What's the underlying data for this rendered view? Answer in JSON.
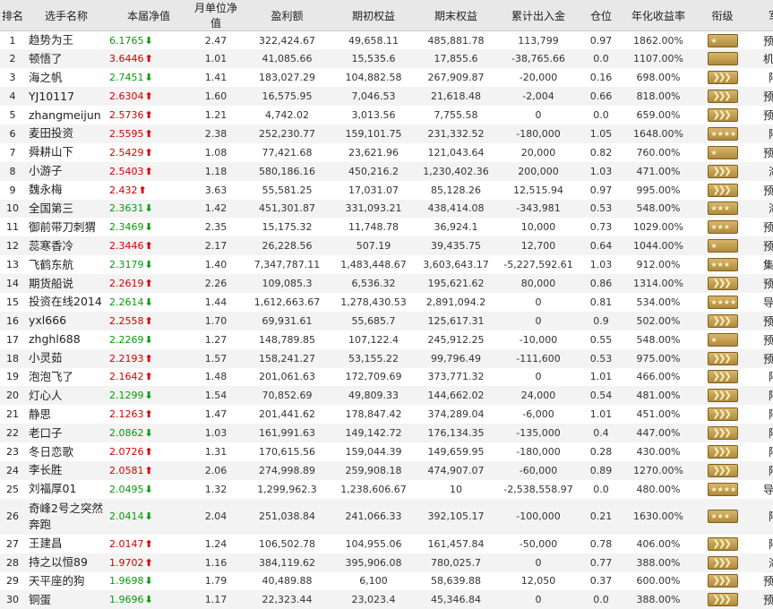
{
  "headers": [
    "排名",
    "选手名称",
    "本届净值",
    "月单位净值",
    "盈利额",
    "期初权益",
    "期末权益",
    "累计出入金",
    "仓位",
    "年化收益率",
    "衔级",
    "军种"
  ],
  "rows": [
    {
      "rank": "1",
      "name": "趋势为王",
      "nav": "6.1765",
      "dir": "down",
      "unit": "2.47",
      "profit": "322,424.67",
      "start": "49,658.11",
      "end": "485,881.78",
      "flow": "113,799",
      "pos": "0.97",
      "annual": "1862.00%",
      "badge": "stripe1",
      "army": "预备役"
    },
    {
      "rank": "2",
      "name": "顿悟了",
      "nav": "3.6446",
      "dir": "up",
      "unit": "1.01",
      "profit": "41,085.66",
      "start": "15,535.6",
      "end": "17,855.6",
      "flow": "-38,765.66",
      "pos": "0.0",
      "annual": "1107.00%",
      "badge": "stripe0",
      "army": "机枪手"
    },
    {
      "rank": "3",
      "name": "海之帆",
      "nav": "2.7451",
      "dir": "down",
      "unit": "1.41",
      "profit": "183,027.29",
      "start": "104,882.58",
      "end": "267,909.87",
      "flow": "-20,000",
      "pos": "0.16",
      "annual": "698.00%",
      "badge": "chev",
      "army": "陆军"
    },
    {
      "rank": "4",
      "name": "YJ10117",
      "nav": "2.6304",
      "dir": "up",
      "unit": "1.60",
      "profit": "16,575.95",
      "start": "7,046.53",
      "end": "21,618.48",
      "flow": "-2,004",
      "pos": "0.66",
      "annual": "818.00%",
      "badge": "chev",
      "army": "预备役"
    },
    {
      "rank": "5",
      "name": "zhangmeijun",
      "nav": "2.5736",
      "dir": "up",
      "unit": "1.21",
      "profit": "4,742.02",
      "start": "3,013.56",
      "end": "7,755.58",
      "flow": "0",
      "pos": "0.0",
      "annual": "659.00%",
      "badge": "chev",
      "army": "预备役"
    },
    {
      "rank": "6",
      "name": "麦田投资",
      "nav": "2.5595",
      "dir": "up",
      "unit": "2.38",
      "profit": "252,230.77",
      "start": "159,101.75",
      "end": "231,332.52",
      "flow": "-180,000",
      "pos": "1.05",
      "annual": "1648.00%",
      "badge": "stripe4",
      "army": "陆军"
    },
    {
      "rank": "7",
      "name": "舜耕山下",
      "nav": "2.5429",
      "dir": "up",
      "unit": "1.08",
      "profit": "77,421.68",
      "start": "23,621.96",
      "end": "121,043.64",
      "flow": "20,000",
      "pos": "0.82",
      "annual": "760.00%",
      "badge": "stripe1",
      "army": "预备役"
    },
    {
      "rank": "8",
      "name": "小游子",
      "nav": "2.5403",
      "dir": "up",
      "unit": "1.18",
      "profit": "580,186.16",
      "start": "450,216.2",
      "end": "1,230,402.36",
      "flow": "200,000",
      "pos": "1.03",
      "annual": "471.00%",
      "badge": "chev",
      "army": "海军"
    },
    {
      "rank": "9",
      "name": "魏永梅",
      "nav": "2.432",
      "dir": "up",
      "unit": "3.63",
      "profit": "55,581.25",
      "start": "17,031.07",
      "end": "85,128.26",
      "flow": "12,515.94",
      "pos": "0.97",
      "annual": "995.00%",
      "badge": "chev",
      "army": "预备役"
    },
    {
      "rank": "10",
      "name": "全国第三",
      "nav": "2.3631",
      "dir": "down",
      "unit": "1.42",
      "profit": "451,301.87",
      "start": "331,093.21",
      "end": "438,414.08",
      "flow": "-343,981",
      "pos": "0.53",
      "annual": "548.00%",
      "badge": "stripe3",
      "army": "海军"
    },
    {
      "rank": "11",
      "name": "御前带刀刺猬",
      "nav": "2.3469",
      "dir": "down",
      "unit": "2.35",
      "profit": "15,175.32",
      "start": "11,748.78",
      "end": "36,924.1",
      "flow": "10,000",
      "pos": "0.73",
      "annual": "1029.00%",
      "badge": "stripe3",
      "army": "预备役"
    },
    {
      "rank": "12",
      "name": "蕊寒香冷",
      "nav": "2.3446",
      "dir": "up",
      "unit": "2.17",
      "profit": "26,228.56",
      "start": "507.19",
      "end": "39,435.75",
      "flow": "12,700",
      "pos": "0.64",
      "annual": "1044.00%",
      "badge": "stripe1",
      "army": "预备役"
    },
    {
      "rank": "13",
      "name": "飞鹤东航",
      "nav": "2.3179",
      "dir": "down",
      "unit": "1.40",
      "profit": "7,347,787.11",
      "start": "1,483,448.67",
      "end": "3,603,643.17",
      "flow": "-5,227,592.61",
      "pos": "1.03",
      "annual": "912.00%",
      "badge": "stripe3",
      "army": "集团军"
    },
    {
      "rank": "14",
      "name": "期货船说",
      "nav": "2.2619",
      "dir": "up",
      "unit": "2.26",
      "profit": "109,085.3",
      "start": "6,536.32",
      "end": "195,621.62",
      "flow": "80,000",
      "pos": "0.86",
      "annual": "1314.00%",
      "badge": "chev",
      "army": "预备役"
    },
    {
      "rank": "15",
      "name": "投资在线2014",
      "nav": "2.2614",
      "dir": "down",
      "unit": "1.44",
      "profit": "1,612,663.67",
      "start": "1,278,430.53",
      "end": "2,891,094.2",
      "flow": "0",
      "pos": "0.81",
      "annual": "534.00%",
      "badge": "stripe4",
      "army": "导弹部"
    },
    {
      "rank": "16",
      "name": "yxl666",
      "nav": "2.2558",
      "dir": "up",
      "unit": "1.70",
      "profit": "69,931.61",
      "start": "55,685.7",
      "end": "125,617.31",
      "flow": "0",
      "pos": "0.9",
      "annual": "502.00%",
      "badge": "chev",
      "army": "预备役"
    },
    {
      "rank": "17",
      "name": "zhghl688",
      "nav": "2.2269",
      "dir": "down",
      "unit": "1.27",
      "profit": "148,789.85",
      "start": "107,122.4",
      "end": "245,912.25",
      "flow": "-10,000",
      "pos": "0.55",
      "annual": "548.00%",
      "badge": "stripe1",
      "army": "预备役"
    },
    {
      "rank": "18",
      "name": "小灵茹",
      "nav": "2.2193",
      "dir": "up",
      "unit": "1.57",
      "profit": "158,241.27",
      "start": "53,155.22",
      "end": "99,796.49",
      "flow": "-111,600",
      "pos": "0.53",
      "annual": "975.00%",
      "badge": "chev",
      "army": "预备役"
    },
    {
      "rank": "19",
      "name": "泡泡飞了",
      "nav": "2.1642",
      "dir": "up",
      "unit": "1.48",
      "profit": "201,061.63",
      "start": "172,709.69",
      "end": "373,771.32",
      "flow": "0",
      "pos": "1.01",
      "annual": "466.00%",
      "badge": "chev",
      "army": "陆军"
    },
    {
      "rank": "20",
      "name": "灯心人",
      "nav": "2.1299",
      "dir": "down",
      "unit": "1.54",
      "profit": "70,852.69",
      "start": "49,809.33",
      "end": "144,662.02",
      "flow": "24,000",
      "pos": "0.54",
      "annual": "481.00%",
      "badge": "chev",
      "army": "陆军"
    },
    {
      "rank": "21",
      "name": "静思",
      "nav": "2.1263",
      "dir": "up",
      "unit": "1.47",
      "profit": "201,441.62",
      "start": "178,847.42",
      "end": "374,289.04",
      "flow": "-6,000",
      "pos": "1.01",
      "annual": "451.00%",
      "badge": "chev",
      "army": "陆军"
    },
    {
      "rank": "22",
      "name": "老口子",
      "nav": "2.0862",
      "dir": "down",
      "unit": "1.03",
      "profit": "161,991.63",
      "start": "149,142.72",
      "end": "176,134.35",
      "flow": "-135,000",
      "pos": "0.4",
      "annual": "447.00%",
      "badge": "chev",
      "army": "陆军"
    },
    {
      "rank": "23",
      "name": "冬日恋歌",
      "nav": "2.0726",
      "dir": "up",
      "unit": "1.31",
      "profit": "170,615.56",
      "start": "159,044.39",
      "end": "149,659.95",
      "flow": "-180,000",
      "pos": "0.28",
      "annual": "430.00%",
      "badge": "chev",
      "army": "陆军"
    },
    {
      "rank": "24",
      "name": "李长胜",
      "nav": "2.0581",
      "dir": "up",
      "unit": "2.06",
      "profit": "274,998.89",
      "start": "259,908.18",
      "end": "474,907.07",
      "flow": "-60,000",
      "pos": "0.89",
      "annual": "1270.00%",
      "badge": "chev",
      "army": "陆军"
    },
    {
      "rank": "25",
      "name": "刘福厚01",
      "nav": "2.0495",
      "dir": "down",
      "unit": "1.32",
      "profit": "1,299,962.3",
      "start": "1,238,606.67",
      "end": "10",
      "flow": "-2,538,558.97",
      "pos": "0.0",
      "annual": "480.00%",
      "badge": "stripe4",
      "army": "导弹部"
    },
    {
      "rank": "26",
      "name": "奇峰2号之突然奔跑",
      "nav": "2.0414",
      "dir": "down",
      "unit": "2.04",
      "profit": "251,038.84",
      "start": "241,066.33",
      "end": "392,105.17",
      "flow": "-100,000",
      "pos": "0.21",
      "annual": "1630.00%",
      "badge": "stripe3",
      "army": "陆军",
      "tall": true
    },
    {
      "rank": "27",
      "name": "王建昌",
      "nav": "2.0147",
      "dir": "up",
      "unit": "1.24",
      "profit": "106,502.78",
      "start": "104,955.06",
      "end": "161,457.84",
      "flow": "-50,000",
      "pos": "0.78",
      "annual": "406.00%",
      "badge": "chev",
      "army": "陆军"
    },
    {
      "rank": "28",
      "name": "持之以恒89",
      "nav": "1.9702",
      "dir": "up",
      "unit": "1.16",
      "profit": "384,119.62",
      "start": "395,906.08",
      "end": "780,025.7",
      "flow": "0",
      "pos": "0.77",
      "annual": "388.00%",
      "badge": "chev",
      "army": "海军"
    },
    {
      "rank": "29",
      "name": "天平座的狗",
      "nav": "1.9698",
      "dir": "down",
      "unit": "1.79",
      "profit": "40,489.88",
      "start": "6,100",
      "end": "58,639.88",
      "flow": "12,050",
      "pos": "0.37",
      "annual": "600.00%",
      "badge": "chev",
      "army": "预备役"
    },
    {
      "rank": "30",
      "name": "铜蛋",
      "nav": "1.9696",
      "dir": "down",
      "unit": "1.17",
      "profit": "22,323.44",
      "start": "23,023.4",
      "end": "45,346.84",
      "flow": "0",
      "pos": "0.0",
      "annual": "388.00%",
      "badge": "chev",
      "army": "预备役"
    }
  ],
  "arrows": {
    "up": "⬆",
    "down": "⬇"
  }
}
